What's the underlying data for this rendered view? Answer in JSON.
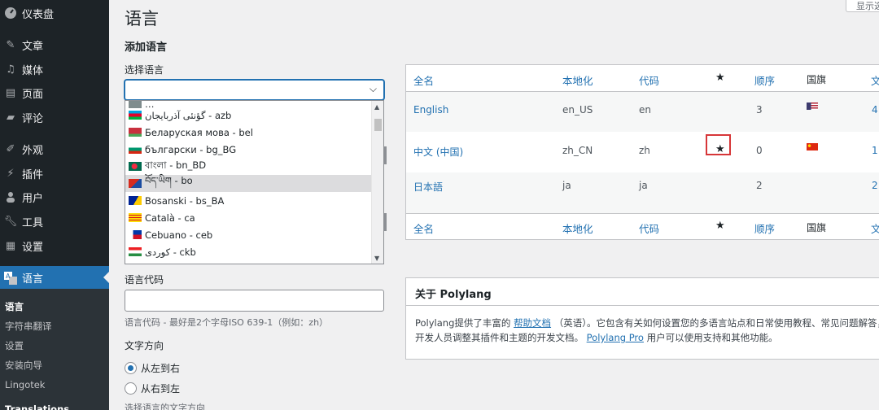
{
  "sidebar": {
    "items": [
      {
        "label": "仪表盘",
        "icon": "dashboard-icon"
      },
      {
        "label": "文章",
        "icon": "pin-icon"
      },
      {
        "label": "媒体",
        "icon": "media-icon"
      },
      {
        "label": "页面",
        "icon": "page-icon"
      },
      {
        "label": "评论",
        "icon": "comment-icon"
      },
      {
        "label": "外观",
        "icon": "appearance-icon"
      },
      {
        "label": "插件",
        "icon": "plugin-icon"
      },
      {
        "label": "用户",
        "icon": "user-icon"
      },
      {
        "label": "工具",
        "icon": "wrench-icon"
      },
      {
        "label": "设置",
        "icon": "settings-icon"
      },
      {
        "label": "语言",
        "icon": "translate-icon"
      }
    ],
    "submenu": [
      "语言",
      "字符串翻译",
      "设置",
      "安装向导",
      "Lingotek",
      "Translations"
    ]
  },
  "header": {
    "title": "语言",
    "screen_options": "显示选项"
  },
  "form": {
    "section_title": "添加语言",
    "select_label": "选择语言",
    "code_label": "语言代码",
    "code_help": "语言代码 - 最好是2个字母ISO 639-1（例如：zh）",
    "dir_label": "文字方向",
    "ltr": "从左到右",
    "rtl": "从右到左",
    "dir_help": "选择语言的文字方向"
  },
  "dropdown": {
    "options": [
      {
        "label": "گؤنئی آذربایجان - azb",
        "flag": "#6ab04c"
      },
      {
        "label": "Беларуская мова - bel",
        "flag": "#c0392b"
      },
      {
        "label": "български - bg_BG",
        "flag": "#27ae60"
      },
      {
        "label": "বাংলা - bn_BD",
        "flag": "#1e8449"
      },
      {
        "label": "བོད་ཡིག - bo",
        "flag": "#b03a2e"
      },
      {
        "label": "Bosanski - bs_BA",
        "flag": "#1f4e9e"
      },
      {
        "label": "Català - ca",
        "flag": "#f1c40f"
      },
      {
        "label": "Cebuano - ceb",
        "flag": "#2e64c9"
      },
      {
        "label": "کوردی - ckb",
        "flag": "#e74c3c"
      }
    ],
    "highlighted_index": 4
  },
  "table": {
    "headers": [
      "全名",
      "本地化",
      "代码",
      "★",
      "顺序",
      "国旗",
      "文"
    ],
    "rows": [
      {
        "name": "English",
        "locale": "en_US",
        "code": "en",
        "default": false,
        "order": "3",
        "flag": "us",
        "count": "4"
      },
      {
        "name": "中文 (中国)",
        "locale": "zh_CN",
        "code": "zh",
        "default": true,
        "order": "0",
        "flag": "cn",
        "count": "1"
      },
      {
        "name": "日本語",
        "locale": "ja",
        "code": "ja",
        "default": false,
        "order": "2",
        "flag": "",
        "count": "2"
      }
    ]
  },
  "about": {
    "title": "关于 Polylang",
    "line1_pre": "Polylang提供了丰富的",
    "line1_link": "帮助文档",
    "line1_post": "（英语）。它包含有关如何设置您的多语言站点和日常使用教程、常见问题解答，",
    "line2_pre": "开发人员调整其插件和主题的开发文档。",
    "line2_link": "Polylang Pro",
    "line2_post": "用户可以使用支持和其他功能。"
  },
  "colors": {
    "accent": "#2271b1",
    "sidebar": "#1d2327",
    "highlight_box": "#d63638"
  }
}
